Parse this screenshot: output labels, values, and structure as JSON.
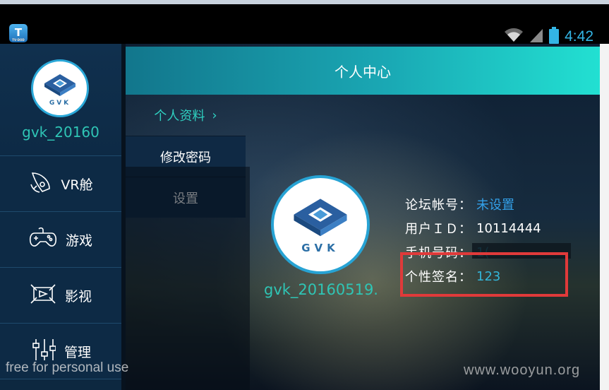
{
  "status_bar": {
    "app_icon_letter": "T",
    "app_icon_caption": "TV·DOD",
    "time": "4:42",
    "icons": [
      "wifi-icon",
      "signal-icon",
      "battery-icon"
    ],
    "accent_color": "#33b5e5"
  },
  "sidebar": {
    "avatar_logo_text": "GVK",
    "username": "gvk_20160",
    "items": [
      {
        "label": "VR舱",
        "icon": "rocket-icon"
      },
      {
        "label": "游戏",
        "icon": "gamepad-icon"
      },
      {
        "label": "影视",
        "icon": "film-icon"
      },
      {
        "label": "管理",
        "icon": "settings-slider-icon"
      }
    ]
  },
  "header": {
    "title": "个人中心"
  },
  "submenu": {
    "items": [
      {
        "label": "个人资料",
        "active": true
      },
      {
        "label": "修改密码",
        "active": false
      },
      {
        "label": "设置",
        "active": false
      }
    ]
  },
  "profile": {
    "avatar_logo_text": "GVK",
    "username": "gvk_20160519.",
    "fields": [
      {
        "label": "论坛帐号：",
        "value": "未设置"
      },
      {
        "label": "用户ＩＤ：",
        "value": "10114444"
      },
      {
        "label": "手机号码：",
        "value": "1("
      },
      {
        "label": "个性签名：",
        "value": "123"
      }
    ]
  },
  "watermarks": {
    "left": "free for personal use",
    "right": "www.wooyun.org"
  },
  "colors": {
    "title_gradient_start": "#12768c",
    "title_gradient_end": "#22e0d2",
    "name_teal": "#2fc5b5",
    "link_blue": "#33a0e8",
    "highlight_red": "#e03a3a"
  }
}
